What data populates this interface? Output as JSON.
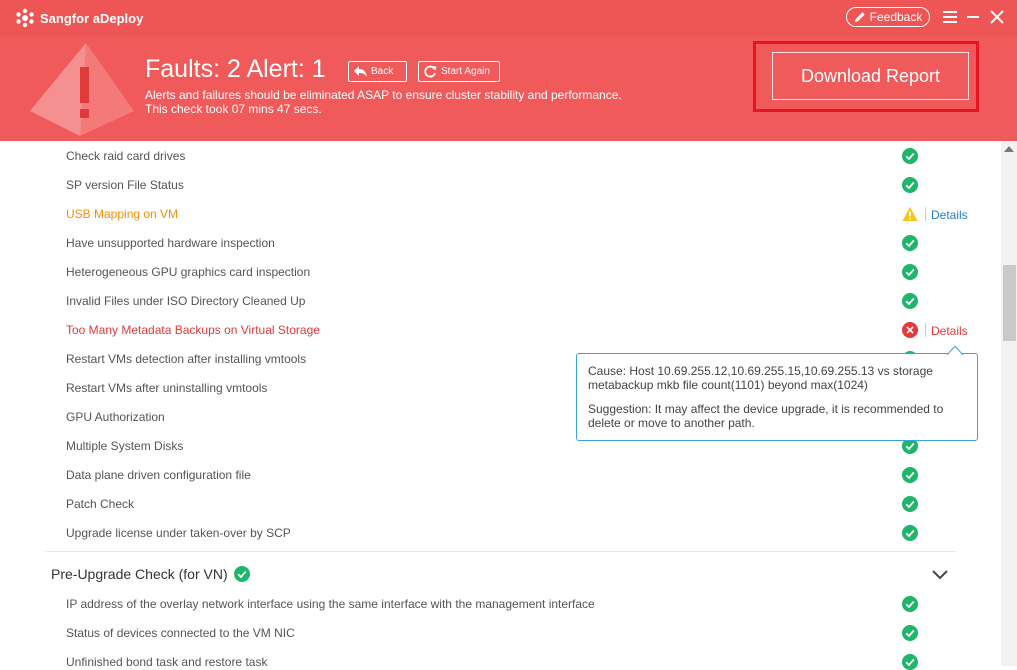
{
  "app": {
    "title": "Sangfor aDeploy"
  },
  "header": {
    "feedback_label": "Feedback",
    "faults_title": "Faults: 2 Alert: 1",
    "back_label": "Back",
    "start_again_label": "Start Again",
    "desc_line1": "Alerts and failures should be eliminated ASAP to ensure cluster stability and performance.",
    "desc_line2": "This check took 07 mins 47 secs.",
    "download_label": "Download Report"
  },
  "checks": [
    {
      "label": "Check raid card drives",
      "status": "ok"
    },
    {
      "label": "SP version File Status",
      "status": "ok"
    },
    {
      "label": "USB Mapping on VM",
      "status": "warning",
      "details": "Details"
    },
    {
      "label": "Have unsupported hardware inspection",
      "status": "ok"
    },
    {
      "label": "Heterogeneous GPU graphics card inspection",
      "status": "ok"
    },
    {
      "label": "Invalid Files under ISO Directory Cleaned Up",
      "status": "ok"
    },
    {
      "label": "Too Many Metadata Backups on Virtual Storage",
      "status": "fault",
      "details": "Details"
    },
    {
      "label": "Restart VMs detection after installing vmtools",
      "status": "ok"
    },
    {
      "label": "Restart VMs after uninstalling vmtools",
      "status": "ok"
    },
    {
      "label": "GPU Authorization",
      "status": "ok"
    },
    {
      "label": "Multiple System Disks",
      "status": "ok"
    },
    {
      "label": "Data plane driven configuration file",
      "status": "ok"
    },
    {
      "label": "Patch Check",
      "status": "ok"
    },
    {
      "label": "Upgrade license under taken-over by SCP",
      "status": "ok"
    }
  ],
  "section2": {
    "title": "Pre-Upgrade Check (for VN)",
    "status": "ok",
    "items": [
      {
        "label": "IP address of the overlay network interface using the same interface with the management interface",
        "status": "ok"
      },
      {
        "label": "Status of devices connected to the VM NIC",
        "status": "ok"
      },
      {
        "label": "Unfinished bond task and restore task",
        "status": "ok"
      }
    ]
  },
  "tooltip": {
    "cause_line1": "Cause: Host 10.69.255.12,10.69.255.15,10.69.255.13 vs storage",
    "cause_line2": "metabackup mkb file count(1101) beyond max(1024)",
    "suggestion_line1": "Suggestion: It may affect the device upgrade, it is recommended to",
    "suggestion_line2": "delete or move to another path."
  },
  "colors": {
    "header_red": "#f05a5a",
    "ok_green": "#1fb56a",
    "warning_yellow": "#f5c518",
    "fault_red": "#e5393b",
    "link_blue": "#2a7fc4",
    "highlight_red": "#e8141e"
  },
  "icons": {
    "logo": "sangfor-logo-icon",
    "feedback": "pencil-icon",
    "menu": "hamburger-menu-icon",
    "minimize": "minimize-icon",
    "close": "close-icon",
    "header_graphic": "warning-triangle-icon",
    "back": "back-arrow-icon",
    "start_again": "refresh-icon",
    "ok": "check-circle-icon",
    "warning": "warning-triangle-icon",
    "fault": "x-circle-icon",
    "collapse": "chevron-down-icon"
  }
}
